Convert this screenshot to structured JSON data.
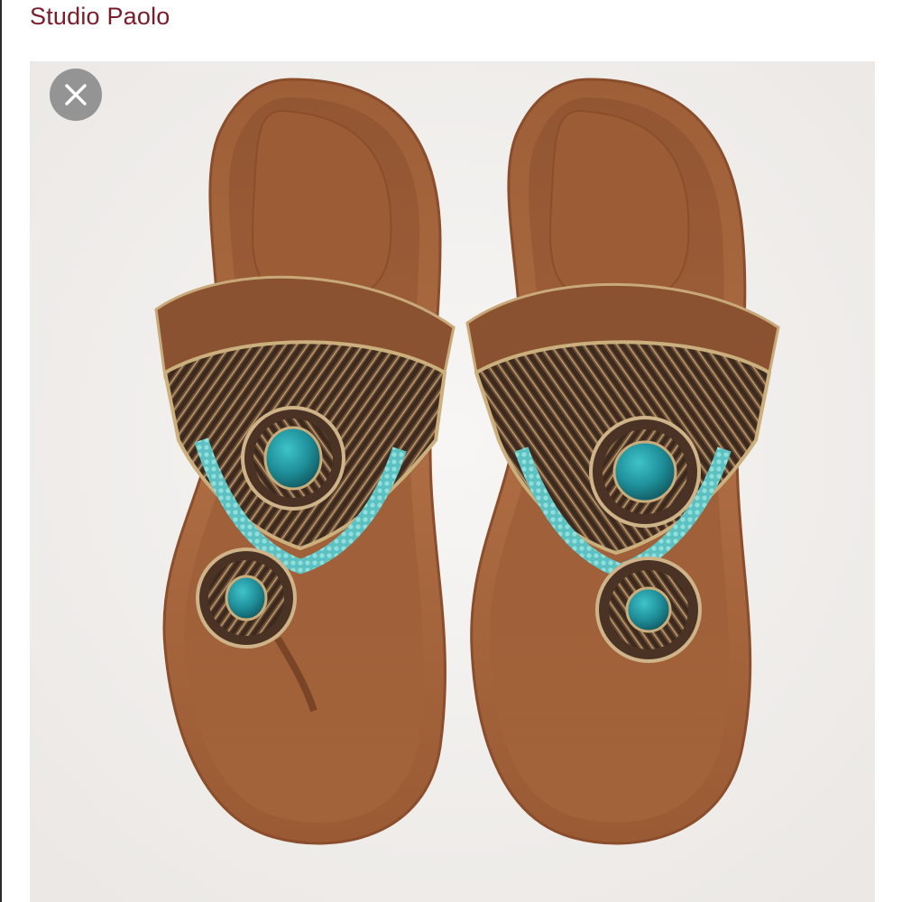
{
  "header": {
    "title": "Studio Paolo",
    "title_color": "#7a1c2a"
  },
  "photo": {
    "icon": "sandals-photo",
    "close_icon": "close-icon",
    "colors": {
      "leather": "#a8683e",
      "turquoise": "#2aa7b0",
      "bead_light": "#7fd6d4",
      "background": "#f3f1ef"
    }
  }
}
